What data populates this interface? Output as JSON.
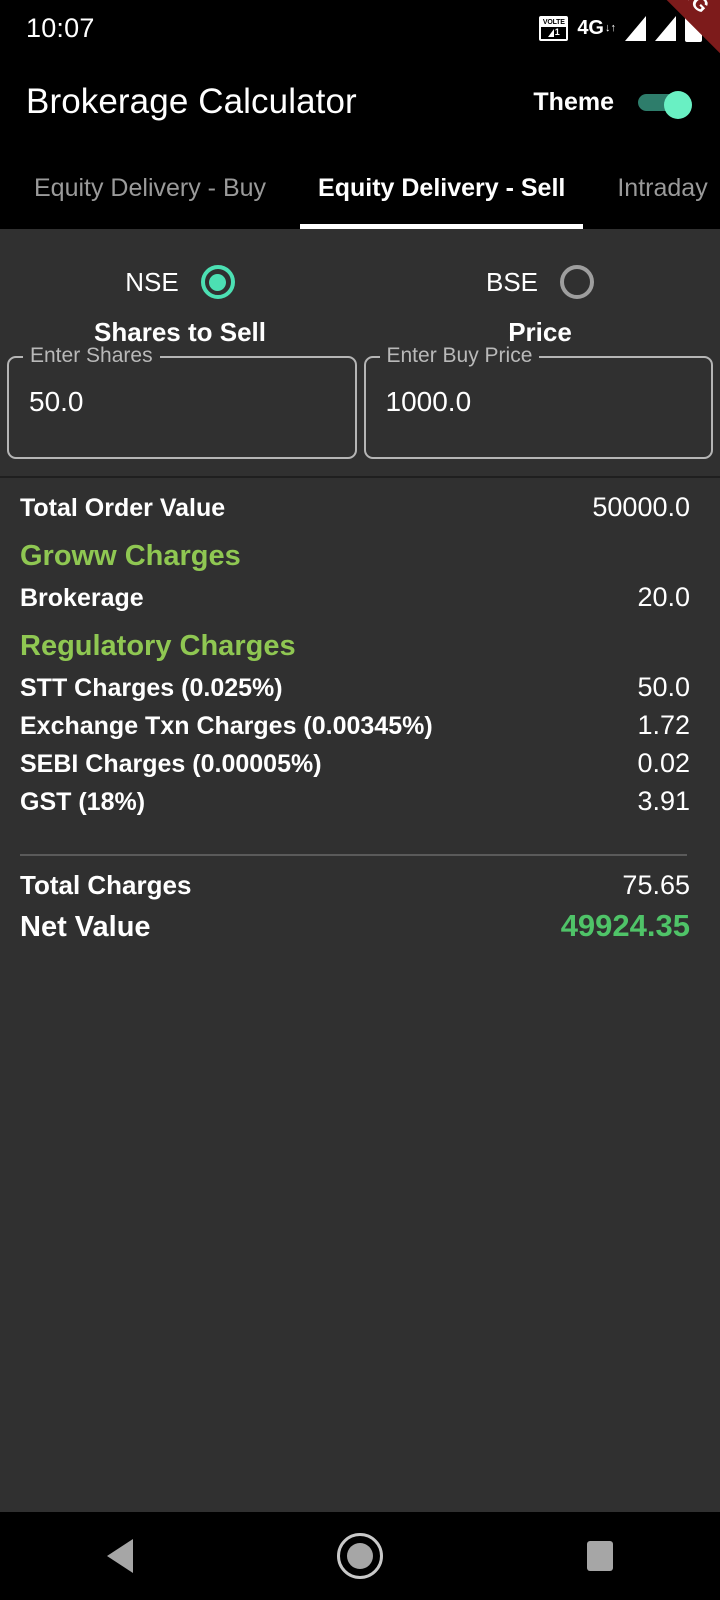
{
  "status_bar": {
    "time": "10:07",
    "volte_label": "VOLTE",
    "volte_sim": "1",
    "network_type": "4G",
    "icons": [
      "volte-icon",
      "signal-4g-icon",
      "signal-bars-icon-1",
      "signal-bars-icon-2",
      "battery-icon"
    ]
  },
  "debug_banner": {
    "label": "DEBUG",
    "color": "#7d1b1b"
  },
  "app_bar": {
    "title": "Brokerage Calculator",
    "theme_label": "Theme",
    "theme_enabled": true,
    "accent_color": "#69f0c3"
  },
  "tabs": [
    {
      "label": "Equity Delivery - Buy",
      "active": false
    },
    {
      "label": "Equity Delivery - Sell",
      "active": true
    },
    {
      "label": "Intraday",
      "active": false
    }
  ],
  "exchange": {
    "options": [
      {
        "label": "NSE",
        "selected": true
      },
      {
        "label": "BSE",
        "selected": false
      }
    ],
    "selected_color": "#4ce0b3",
    "unselected_color": "#9e9e9e"
  },
  "form": {
    "shares": {
      "header": "Shares to Sell",
      "floating_label": "Enter Shares",
      "value": "50.0",
      "placeholder": "Enter Shares"
    },
    "price": {
      "header": "Price",
      "floating_label": "Enter Buy Price",
      "value": "1000.0",
      "placeholder": "Enter Buy Price"
    }
  },
  "results": {
    "order_value": {
      "label": "Total Order Value",
      "value": "50000.0"
    },
    "groww_section": {
      "title": "Groww Charges",
      "color": "#8fc752",
      "rows": [
        {
          "label": "Brokerage",
          "value": "20.0"
        }
      ]
    },
    "regulatory_section": {
      "title": "Regulatory Charges",
      "color": "#8fc752",
      "rows": [
        {
          "label": "STT Charges (0.025%)",
          "value": "50.0"
        },
        {
          "label": "Exchange Txn Charges (0.00345%)",
          "value": "1.72"
        },
        {
          "label": "SEBI Charges (0.00005%)",
          "value": "0.02"
        },
        {
          "label": "GST (18%)",
          "value": "3.91"
        }
      ]
    },
    "total_charges": {
      "label": "Total Charges",
      "value": "75.65"
    },
    "net_value": {
      "label": "Net Value",
      "value": "49924.35",
      "color": "#4fc368"
    }
  },
  "nav_bar": {
    "back": "back-icon",
    "home": "home-icon",
    "recents": "recents-icon"
  }
}
